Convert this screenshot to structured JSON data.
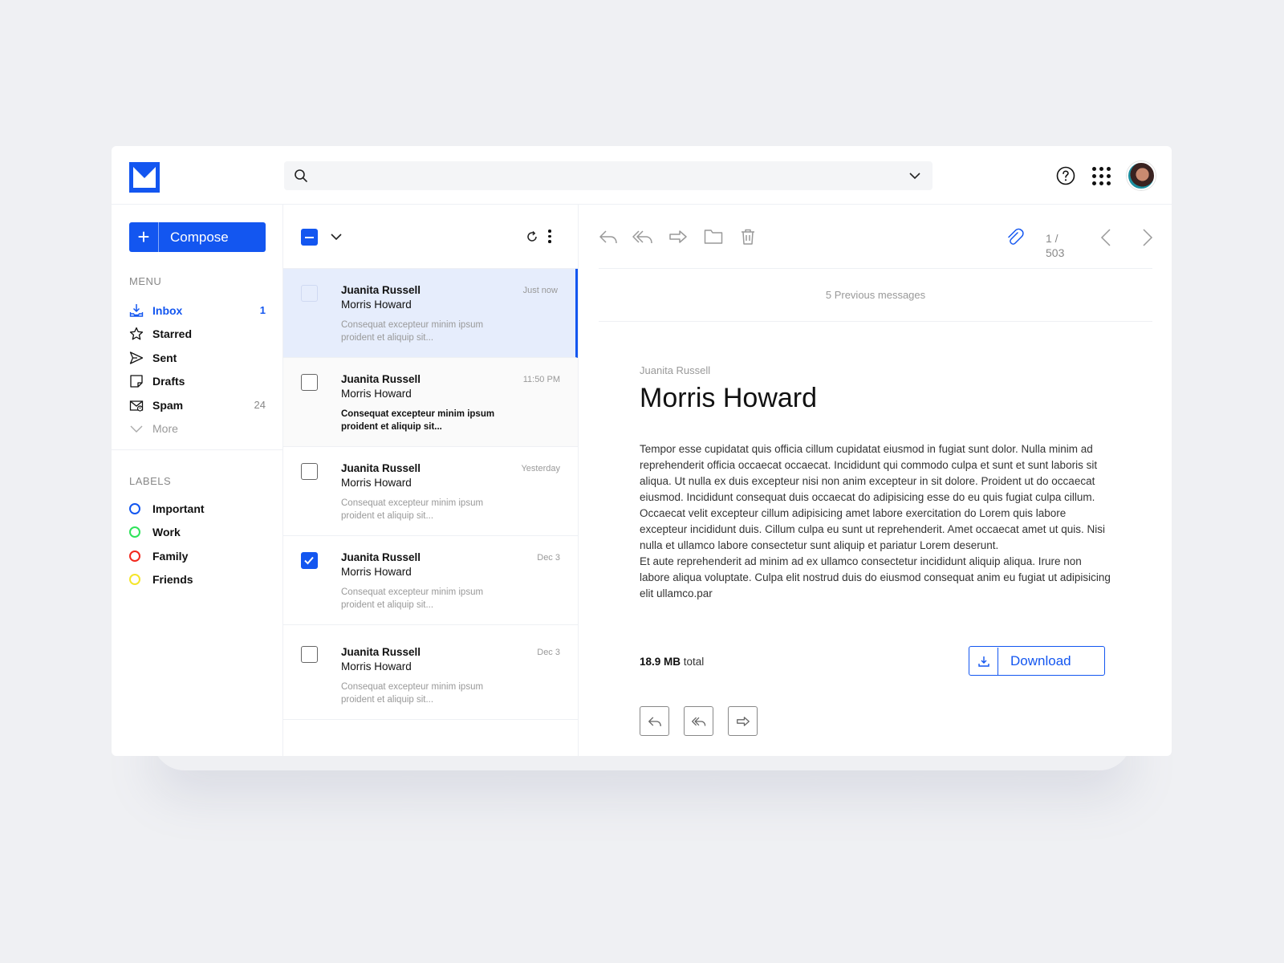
{
  "app": {
    "brand_color": "#1356f0",
    "logo_icon": "mail-logo-icon"
  },
  "search": {
    "placeholder": ""
  },
  "sidebar": {
    "compose_label": "Compose",
    "menu_title": "MENU",
    "menu": [
      {
        "label": "Inbox",
        "count": "1",
        "icon": "inbox-icon"
      },
      {
        "label": "Starred",
        "count": "",
        "icon": "star-icon"
      },
      {
        "label": "Sent",
        "count": "",
        "icon": "send-icon"
      },
      {
        "label": "Drafts",
        "count": "",
        "icon": "draft-icon"
      },
      {
        "label": "Spam",
        "count": "24",
        "icon": "spam-icon"
      },
      {
        "label": "More",
        "count": "",
        "icon": "chevron-down-icon"
      }
    ],
    "labels_title": "LABELS",
    "labels": [
      {
        "label": "Important",
        "color": "#1356f0"
      },
      {
        "label": "Work",
        "color": "#2ee35a"
      },
      {
        "label": "Family",
        "color": "#f2281e"
      },
      {
        "label": "Friends",
        "color": "#f5e52a"
      }
    ]
  },
  "messages": [
    {
      "from": "Juanita Russell",
      "to": "Morris Howard",
      "time": "Just now",
      "preview": "Consequat excepteur minim ipsum proident et aliquip sit..."
    },
    {
      "from": "Juanita Russell",
      "to": "Morris Howard",
      "time": "11:50 PM",
      "preview": "Consequat excepteur minim ipsum proident et aliquip sit..."
    },
    {
      "from": "Juanita Russell",
      "to": "Morris Howard",
      "time": "Yesterday",
      "preview": "Consequat excepteur minim ipsum proident et aliquip sit..."
    },
    {
      "from": "Juanita Russell",
      "to": "Morris Howard",
      "time": "Dec 3",
      "preview": "Consequat excepteur minim ipsum proident et aliquip sit..."
    },
    {
      "from": "Juanita Russell",
      "to": "Morris Howard",
      "time": "Dec 3",
      "preview": "Consequat excepteur minim ipsum proident et aliquip sit..."
    }
  ],
  "reader": {
    "counter_current": "1 /",
    "counter_total": "503",
    "previous_messages": "5 Previous messages",
    "sender": "Juanita Russell",
    "subject": "Morris Howard",
    "body": [
      "Tempor esse cupidatat quis officia cillum cupidatat eiusmod in fugiat sunt dolor. Nulla minim ad reprehenderit officia occaecat occaecat. Incididunt qui commodo culpa et sunt et sunt laboris sit aliqua. Ut nulla ex duis excepteur nisi non anim excepteur in sit dolore. Proident ut do occaecat eiusmod. Incididunt consequat duis occaecat do adipisicing esse do eu quis fugiat culpa cillum.",
      "Occaecat velit excepteur cillum adipisicing amet labore exercitation do Lorem quis labore excepteur incididunt duis. Cillum culpa eu sunt ut reprehenderit. Amet occaecat amet ut quis. Nisi nulla et ullamco labore consectetur sunt aliquip et pariatur Lorem deserunt.",
      "Et aute reprehenderit ad minim ad ex ullamco consectetur incididunt aliquip aliqua. Irure non labore aliqua voluptate. Culpa elit nostrud duis do eiusmod consequat anim eu fugiat ut adipisicing elit ullamco.par"
    ],
    "attachment_size": "18.9 MB",
    "attachment_size_suffix": " total",
    "download_label": "Download"
  }
}
